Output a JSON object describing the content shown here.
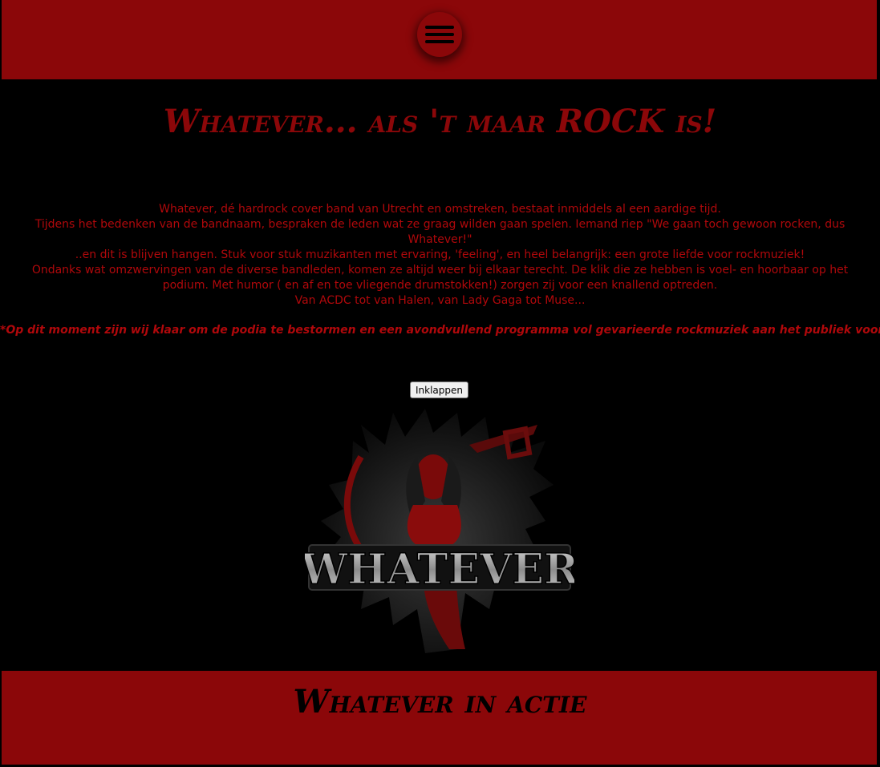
{
  "header": {
    "menu_icon": "hamburger-menu-icon",
    "background_color": "#8b0709"
  },
  "main": {
    "title": "Whatever... als 't maar ROCK is!",
    "intro_lines": [
      "Whatever, dé hardrock cover band van Utrecht en omstreken, bestaat inmiddels al een aardige tijd.",
      "Tijdens het bedenken van de bandnaam, bespraken de leden wat ze graag wilden gaan spelen. Iemand riep \"We gaan toch gewoon rocken, dus Whatever!\"",
      "..en dit is blijven hangen. Stuk voor stuk muzikanten met ervaring, 'feeling', en heel belangrijk: een grote liefde voor rockmuziek!",
      "Ondanks wat omzwervingen van de diverse bandleden, komen ze altijd weer bij elkaar terecht. De klik die ze hebben is voel- en hoorbaar op het podium. Met humor ( en af en toe vliegende drumstokken!) zorgen zij voor een knallend optreden.",
      "Van ACDC tot van Halen, van Lady Gaga tot Muse..."
    ],
    "highlight": "*Op dit moment zijn wij klaar om de podia te bestormen en een avondvullend programma vol gevarieerde rockmuziek aan het publiek voor te schotelen!",
    "collapse_button_label": "Inklappen",
    "logo_text": "WHATEVER"
  },
  "section": {
    "title": "Whatever in actie"
  },
  "colors": {
    "accent": "#8b0709",
    "text_red": "#b0080b",
    "background": "#000000"
  }
}
